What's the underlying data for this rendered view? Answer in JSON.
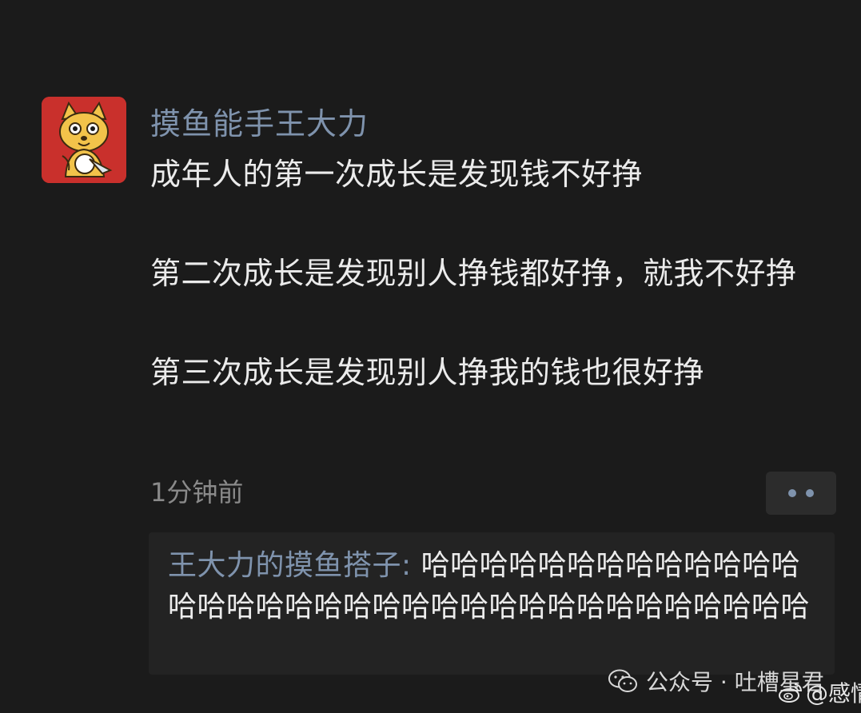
{
  "post": {
    "username": "摸鱼能手王大力",
    "paragraphs": [
      "成年人的第一次成长是发现钱不好挣",
      "第二次成长是发现别人挣钱都好挣，就我不好挣",
      "第三次成长是发现别人挣我的钱也很好挣"
    ],
    "timestamp": "1分钟前",
    "more_icon": "more-dots-icon"
  },
  "comment": {
    "author": "王大力的摸鱼搭子",
    "separator": ": ",
    "text": "哈哈哈哈哈哈哈哈哈哈哈哈哈哈哈哈哈哈哈哈哈哈哈哈哈哈哈哈哈哈哈哈哈哈哈"
  },
  "watermarks": {
    "wechat": "公众号 · 吐槽星君",
    "weibo": "@感情"
  },
  "colors": {
    "background": "#1b1b1b",
    "name_accent": "#7f93ad",
    "avatar_bg": "#c9302c"
  }
}
